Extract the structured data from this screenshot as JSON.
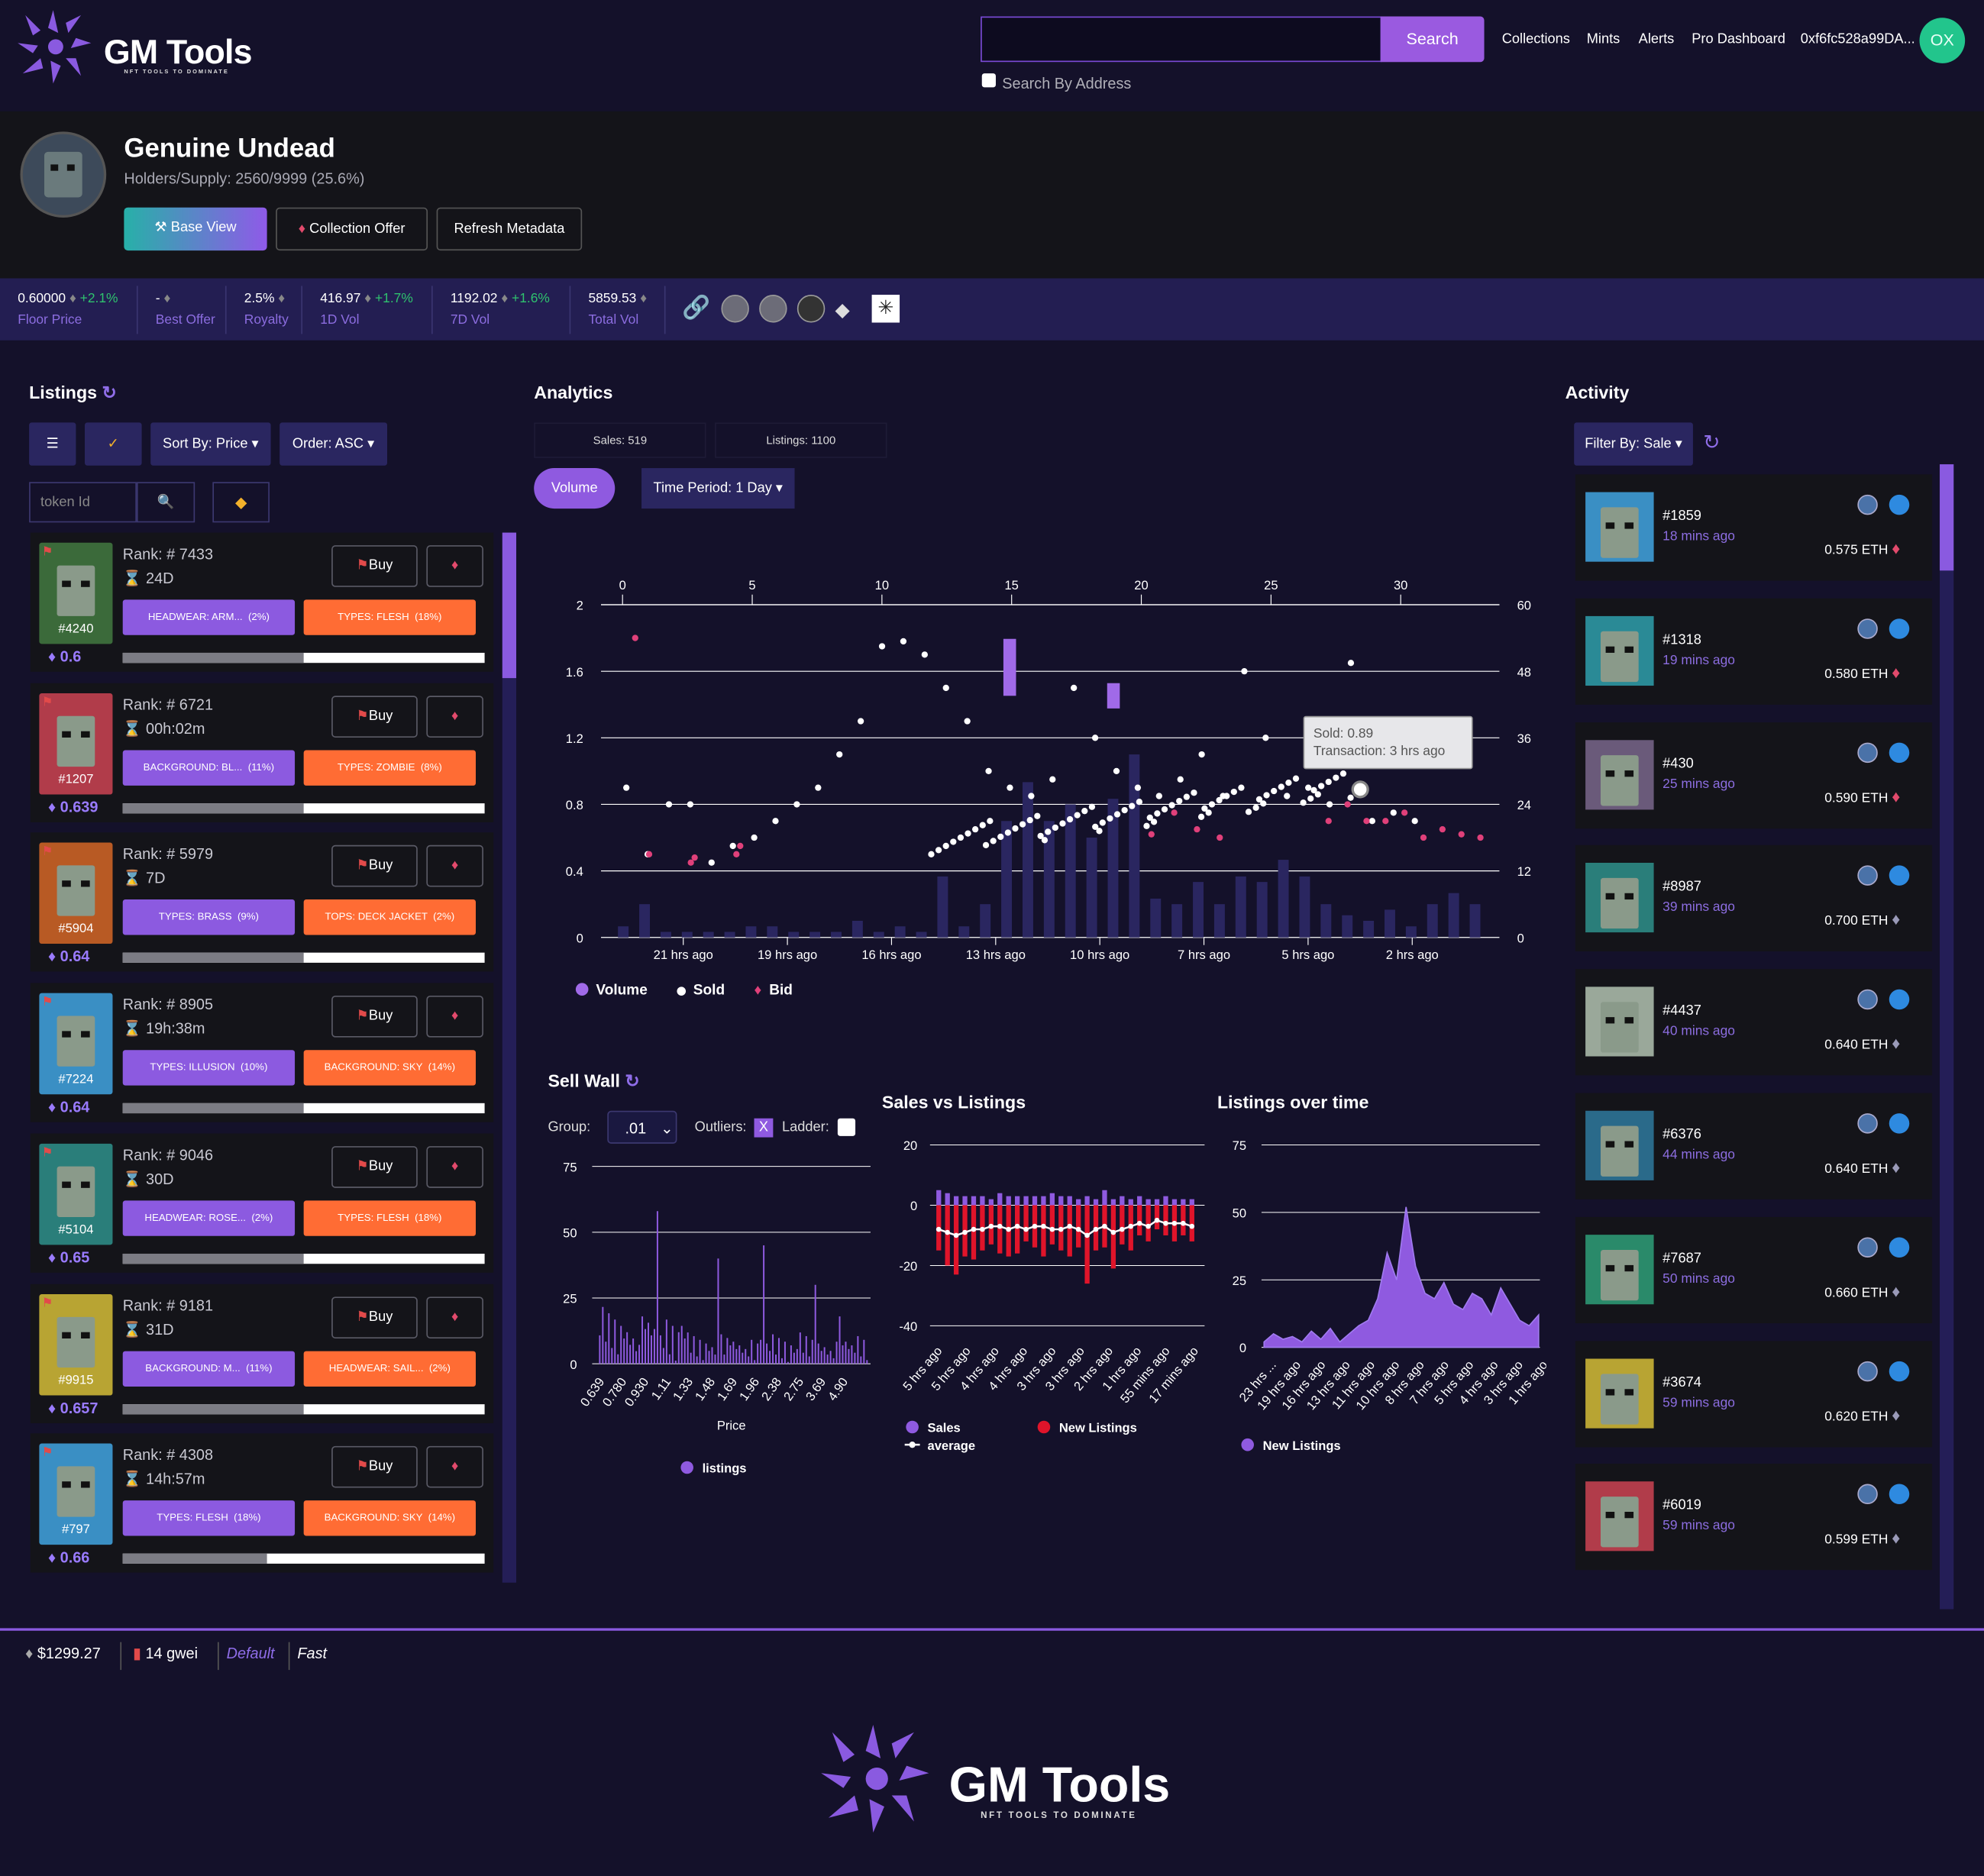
{
  "nav": {
    "logo": "GM Tools",
    "logo_tagline": "NFT TOOLS TO DOMINATE",
    "search_button": "Search",
    "search_by_address": "Search By Address",
    "links": [
      "Collections",
      "Mints",
      "Alerts",
      "Pro Dashboard"
    ],
    "wallet": "0xf6fc528a99DA...",
    "avatar": "OX"
  },
  "collection": {
    "name": "Genuine Undead",
    "holders": "Holders/Supply: 2560/9999 (25.6%)",
    "buttons": {
      "base_view": "Base View",
      "collection_offer": "Collection Offer",
      "refresh": "Refresh Metadata"
    }
  },
  "stats": [
    {
      "value": "0.60000",
      "change": "+2.1%",
      "label": "Floor Price"
    },
    {
      "value": "-",
      "change": "",
      "label": "Best Offer"
    },
    {
      "value": "2.5%",
      "change": "",
      "label": "Royalty"
    },
    {
      "value": "416.97",
      "change": "+1.7%",
      "label": "1D Vol"
    },
    {
      "value": "1192.02",
      "change": "+1.6%",
      "label": "7D Vol"
    },
    {
      "value": "5859.53",
      "change": "",
      "label": "Total Vol"
    }
  ],
  "listings": {
    "title": "Listings",
    "sort": "Sort By: Price",
    "order": "Order: ASC",
    "token_placeholder": "token Id",
    "buy_label": "Buy",
    "rank_prefix": "Rank: #",
    "items": [
      {
        "rank": "7433",
        "time": "24D",
        "id": "#4240",
        "price": "0.6",
        "t1": "HEADWEAR: ARM...",
        "p1": "(2%)",
        "t2": "TYPES: FLESH",
        "p2": "(18%)",
        "fill": 0.5,
        "bg": "#3b6a3a"
      },
      {
        "rank": "6721",
        "time": "00h:02m",
        "id": "#1207",
        "price": "0.639",
        "t1": "BACKGROUND: BL...",
        "p1": "(11%)",
        "t2": "TYPES: ZOMBIE",
        "p2": "(8%)",
        "fill": 0.5,
        "bg": "#b13c4a"
      },
      {
        "rank": "5979",
        "time": "7D",
        "id": "#5904",
        "price": "0.64",
        "t1": "TYPES: BRASS",
        "p1": "(9%)",
        "t2": "TOPS: DECK JACKET",
        "p2": "(2%)",
        "fill": 0.5,
        "bg": "#b85a24"
      },
      {
        "rank": "8905",
        "time": "19h:38m",
        "id": "#7224",
        "price": "0.64",
        "t1": "TYPES: ILLUSION",
        "p1": "(10%)",
        "t2": "BACKGROUND: SKY",
        "p2": "(14%)",
        "fill": 0.5,
        "bg": "#3a8fc4"
      },
      {
        "rank": "9046",
        "time": "30D",
        "id": "#5104",
        "price": "0.65",
        "t1": "HEADWEAR: ROSE...",
        "p1": "(2%)",
        "t2": "TYPES: FLESH",
        "p2": "(18%)",
        "fill": 0.5,
        "bg": "#2a7e7a"
      },
      {
        "rank": "9181",
        "time": "31D",
        "id": "#9915",
        "price": "0.657",
        "t1": "BACKGROUND: M...",
        "p1": "(11%)",
        "t2": "HEADWEAR: SAIL...",
        "p2": "(2%)",
        "fill": 0.5,
        "bg": "#b8a433"
      },
      {
        "rank": "4308",
        "time": "14h:57m",
        "id": "#797",
        "price": "0.66",
        "t1": "TYPES: FLESH",
        "p1": "(18%)",
        "t2": "BACKGROUND: SKY",
        "p2": "(14%)",
        "fill": 0.4,
        "bg": "#3a8fc4"
      }
    ]
  },
  "analytics": {
    "title": "Analytics",
    "sales": "Sales: 519",
    "listings": "Listings: 1100",
    "volume_btn": "Volume",
    "period": "Time Period: 1 Day",
    "tooltip_sold": "Sold: 0.89",
    "tooltip_tx": "Transaction: 3 hrs ago",
    "legend": [
      "Volume",
      "Sold",
      "Bid"
    ]
  },
  "chart_data": [
    {
      "type": "bar",
      "title": "",
      "x_top_ticks": [
        "0",
        "5",
        "10",
        "15",
        "20",
        "25",
        "30"
      ],
      "y_left_ticks": [
        "0",
        "0.4",
        "0.8",
        "1.2",
        "1.6",
        "2"
      ],
      "y_right_ticks": [
        "0",
        "12",
        "24",
        "36",
        "48",
        "60"
      ],
      "x_bottom_ticks": [
        "21 hrs ago",
        "19 hrs ago",
        "16 hrs ago",
        "13 hrs ago",
        "10 hrs ago",
        "7 hrs ago",
        "5 hrs ago",
        "2 hrs ago"
      ],
      "series": [
        {
          "name": "Volume",
          "values": [
            2,
            6,
            1,
            1,
            1,
            1,
            2,
            2,
            1,
            1,
            1,
            3,
            1,
            2,
            1,
            11,
            2,
            6,
            21,
            28,
            21,
            24,
            18,
            25,
            33,
            7,
            6,
            10,
            6,
            11,
            10,
            14,
            11,
            6,
            4,
            3,
            5,
            2,
            6,
            8,
            6
          ]
        },
        {
          "name": "Sold",
          "values": [
            0.9,
            0.5,
            0.8,
            0.8,
            0.45,
            0.55,
            0.6,
            0.7,
            0.8,
            0.9,
            1.1,
            1.3,
            1.75,
            1.78,
            1.7,
            1.5,
            1.3,
            1.0,
            0.9,
            0.85,
            0.95,
            1.5,
            1.2,
            1.0,
            0.9,
            0.85,
            0.95,
            1.1,
            0.85,
            1.6,
            1.2,
            0.85,
            0.9,
            0.8,
            1.65,
            0.7,
            0.75,
            0.7
          ]
        },
        {
          "name": "Bid",
          "values": [
            1.8,
            0.5,
            0.45,
            0.48,
            0.5,
            0.55,
            0.62,
            0.75,
            0.65,
            0.6,
            0.7,
            0.8,
            0.7,
            0.7,
            0.75,
            0.6,
            0.65,
            0.62,
            0.6
          ]
        }
      ]
    },
    {
      "type": "bar",
      "title": "Sell Wall",
      "xlabel": "Price",
      "y_ticks": [
        "0",
        "25",
        "50",
        "75"
      ],
      "categories": [
        "0.639",
        "0.780",
        "0.930",
        "1.11",
        "1.33",
        "1.48",
        "1.69",
        "1.96",
        "2.38",
        "2.75",
        "3.69",
        "4.90"
      ],
      "series": [
        {
          "name": "listings",
          "values": [
            3,
            8,
            12,
            58,
            14,
            6,
            40,
            9,
            45,
            4,
            30,
            3
          ]
        }
      ]
    },
    {
      "type": "bar",
      "title": "Sales vs Listings",
      "y_ticks": [
        "20",
        "0",
        "-20",
        "-40"
      ],
      "categories": [
        "5 hrs ago",
        "5 hrs ago",
        "4 hrs ago",
        "4 hrs ago",
        "3 hrs ago",
        "3 hrs ago",
        "2 hrs ago",
        "1 hrs ago",
        "55 mins ago",
        "17 mins ago"
      ],
      "series": [
        {
          "name": "Sales",
          "values": [
            5,
            4,
            3,
            3,
            3,
            3,
            2,
            4,
            3,
            3,
            3,
            3,
            3,
            4,
            3,
            3,
            2,
            3,
            2,
            5,
            2,
            3,
            2,
            3,
            2,
            2,
            3,
            2,
            2,
            2
          ]
        },
        {
          "name": "New Listings",
          "values": [
            -15,
            -20,
            -23,
            -17,
            -18,
            -15,
            -13,
            -16,
            -17,
            -16,
            -12,
            -14,
            -17,
            -13,
            -15,
            -17,
            -14,
            -26,
            -15,
            -14,
            -21,
            -13,
            -15,
            -10,
            -12,
            -8,
            -10,
            -12,
            -10,
            -12
          ]
        },
        {
          "name": "average",
          "values": [
            -8,
            -9,
            -10,
            -9,
            -8,
            -8,
            -7,
            -7,
            -8,
            -7,
            -8,
            -7,
            -7,
            -8,
            -8,
            -7,
            -8,
            -10,
            -8,
            -7,
            -9,
            -8,
            -7,
            -6,
            -7,
            -5,
            -6,
            -6,
            -6,
            -7
          ]
        }
      ]
    },
    {
      "type": "area",
      "title": "Listings over time",
      "y_ticks": [
        "0",
        "25",
        "50",
        "75"
      ],
      "categories": [
        "23 hrs ...",
        "19 hrs ago",
        "16 hrs ago",
        "13 hrs ago",
        "11 hrs ago",
        "10 hrs ago",
        "8 hrs ago",
        "7 hrs ago",
        "5 hrs ago",
        "4 hrs ago",
        "3 hrs ago",
        "1 hrs ago"
      ],
      "series": [
        {
          "name": "New Listings",
          "values": [
            2,
            5,
            3,
            4,
            2,
            6,
            3,
            7,
            2,
            5,
            8,
            10,
            18,
            35,
            25,
            52,
            30,
            20,
            18,
            24,
            16,
            14,
            20,
            18,
            12,
            22,
            16,
            10,
            8,
            12
          ]
        }
      ]
    }
  ],
  "sellwall": {
    "title": "Sell Wall",
    "group_label": "Group:",
    "group_value": ".01",
    "outliers": "Outliers:",
    "outliers_mark": "X",
    "ladder": "Ladder:"
  },
  "activity": {
    "title": "Activity",
    "filter": "Filter By: Sale",
    "items": [
      {
        "id": "#1859",
        "ago": "18 mins ago",
        "eth": "0.575 ETH",
        "bg": "#3a8fc4"
      },
      {
        "id": "#1318",
        "ago": "19 mins ago",
        "eth": "0.580 ETH",
        "bg": "#2a8a96"
      },
      {
        "id": "#430",
        "ago": "25 mins ago",
        "eth": "0.590 ETH",
        "bg": "#6a5a7a"
      },
      {
        "id": "#8987",
        "ago": "39 mins ago",
        "eth": "0.700 ETH",
        "bg": "#2a7e7a"
      },
      {
        "id": "#4437",
        "ago": "40 mins ago",
        "eth": "0.640 ETH",
        "bg": "#9aa89a"
      },
      {
        "id": "#6376",
        "ago": "44 mins ago",
        "eth": "0.640 ETH",
        "bg": "#2a6a8a"
      },
      {
        "id": "#7687",
        "ago": "50 mins ago",
        "eth": "0.660 ETH",
        "bg": "#2a8a6a"
      },
      {
        "id": "#3674",
        "ago": "59 mins ago",
        "eth": "0.620 ETH",
        "bg": "#b8a433"
      },
      {
        "id": "#6019",
        "ago": "59 mins ago",
        "eth": "0.599 ETH",
        "bg": "#b13c4a"
      }
    ]
  },
  "footer": {
    "eth_price": "$1299.27",
    "gas": "14 gwei",
    "default": "Default",
    "fast": "Fast",
    "logo": "GM Tools",
    "tagline": "NFT TOOLS TO DOMINATE"
  },
  "colors": {
    "accent": "#9a5ae0",
    "orange": "#ff6c34",
    "stats_bg": "#231e52",
    "bid": "#e0407a"
  }
}
